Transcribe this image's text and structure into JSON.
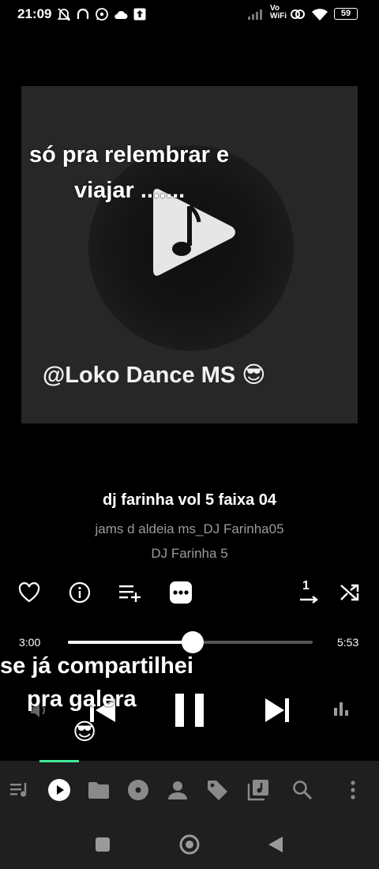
{
  "status_bar": {
    "time": "21:09",
    "battery": "59",
    "volte_label_top": "Vo",
    "volte_label_bottom": "WiFi"
  },
  "album_art": {
    "overlay_text": "só pra relembrar e viajar .......",
    "overlay_line1": "só pra relembrar e",
    "overlay_line2": "viajar .......",
    "watermark": "@Loko Dance MS 😎"
  },
  "track": {
    "title": "dj farinha vol 5 faixa 04",
    "artist": "jams d aldeia ms_DJ Farinha05",
    "album": "DJ Farinha 5"
  },
  "actions": {
    "icons": [
      "heart-icon",
      "info-icon",
      "add-to-queue-icon",
      "more-icon",
      "play-order-icon",
      "shuffle-icon"
    ],
    "play_order_badge": "1"
  },
  "progress": {
    "elapsed": "3:00",
    "duration": "5:53",
    "fraction": 0.51
  },
  "caption": {
    "line1": "se já compartilhei",
    "line2": "pra galera",
    "line3": "😎"
  },
  "tabs": [
    "queue",
    "now-playing",
    "folders",
    "albums",
    "artists",
    "tags",
    "playlists",
    "search",
    "menu"
  ],
  "colors": {
    "accent": "#3ee89a",
    "background": "#000000",
    "bar": "#1f1f1f"
  }
}
